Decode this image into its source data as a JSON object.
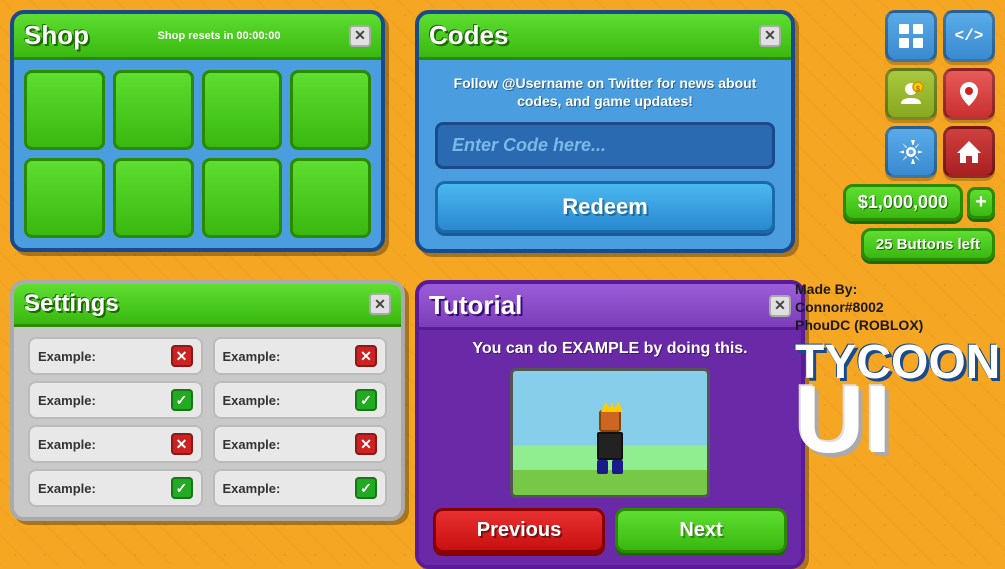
{
  "shop": {
    "title": "Shop",
    "reset_text": "Shop resets in 00:00:00",
    "items": [
      {},
      {},
      {},
      {},
      {},
      {},
      {},
      {}
    ]
  },
  "codes": {
    "title": "Codes",
    "info_text": "Follow @Username on Twitter for news about codes, and game updates!",
    "input_placeholder": "Enter Code here...",
    "redeem_label": "Redeem"
  },
  "icons": {
    "shop_grid": "▦",
    "code_bracket": "</>",
    "gear": "⚙",
    "person_dollar": "👤",
    "location": "📍",
    "home": "🏠"
  },
  "currency": {
    "amount": "$1,000,000",
    "plus_label": "+",
    "buttons_left": "25 Buttons left"
  },
  "settings": {
    "title": "Settings",
    "rows": [
      {
        "label": "Example:",
        "state": "red"
      },
      {
        "label": "Example:",
        "state": "green"
      },
      {
        "label": "Example:",
        "state": "red"
      },
      {
        "label": "Example:",
        "state": "green"
      },
      {
        "label": "Example:",
        "state": "red"
      },
      {
        "label": "Example:",
        "state": "green"
      },
      {
        "label": "Example:",
        "state": "red"
      },
      {
        "label": "Example:",
        "state": "green"
      }
    ]
  },
  "tutorial": {
    "title": "Tutorial",
    "text": "You can do EXAMPLE by doing this.",
    "prev_label": "Previous",
    "next_label": "Next"
  },
  "branding": {
    "made_by_line1": "Made By:",
    "made_by_line2": "Connor#8002",
    "made_by_line3": "PhouDC (ROBLOX)",
    "tycoon": "TYCOON",
    "ui": "UI"
  },
  "close_label": "✕"
}
